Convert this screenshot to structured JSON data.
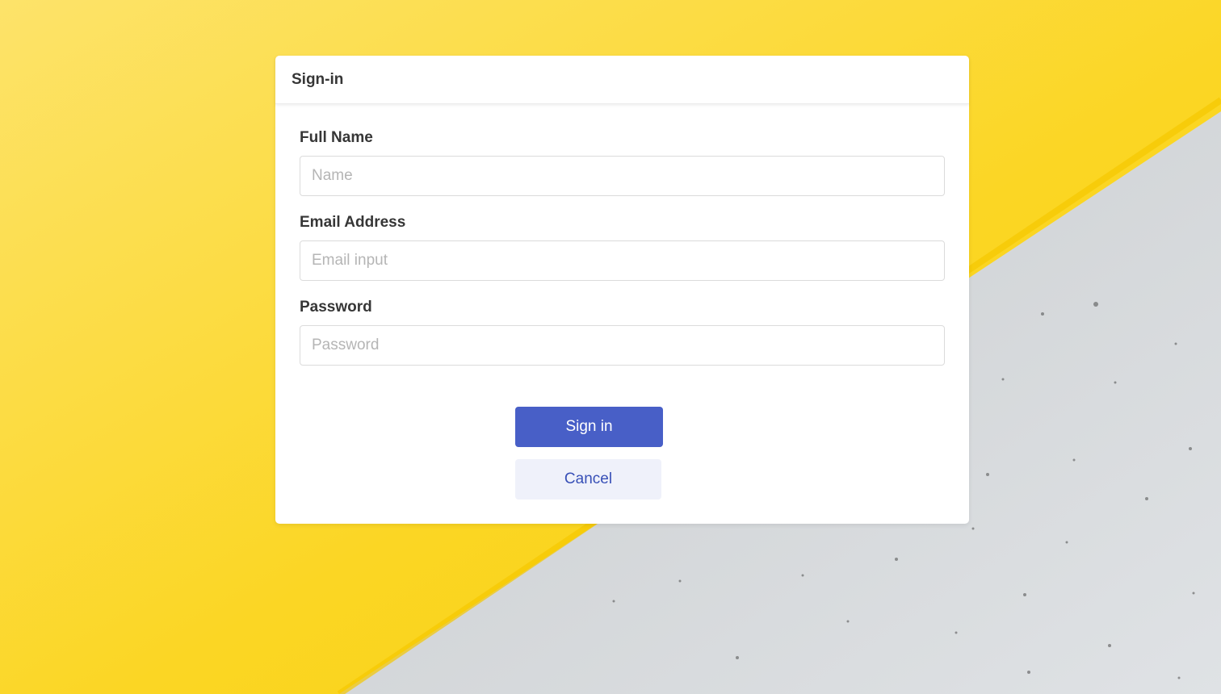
{
  "background": {
    "colors": {
      "yellow": "#fbd50f",
      "concrete": "#d7dadc"
    }
  },
  "modal": {
    "title": "Sign-in",
    "fields": [
      {
        "label": "Full Name",
        "placeholder": "Name",
        "value": ""
      },
      {
        "label": "Email Address",
        "placeholder": "Email input",
        "value": ""
      },
      {
        "label": "Password",
        "placeholder": "Password",
        "value": ""
      }
    ],
    "buttons": {
      "primary_label": "Sign in",
      "cancel_label": "Cancel"
    },
    "colors": {
      "primary": "#485fc7",
      "cancel_bg": "#eff1fa",
      "cancel_text": "#3850b7"
    }
  }
}
